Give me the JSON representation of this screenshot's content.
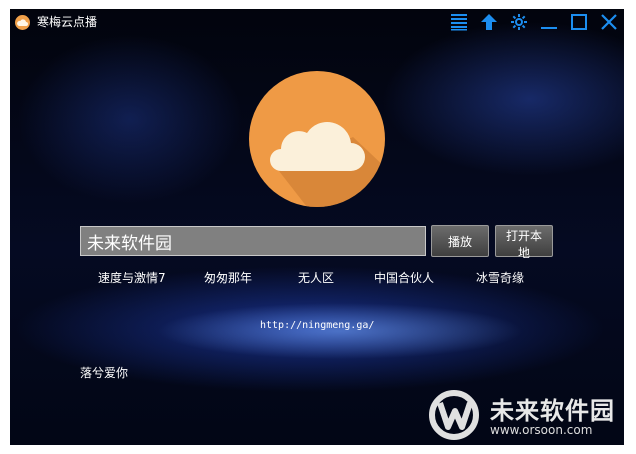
{
  "window": {
    "title": "寒梅云点播"
  },
  "titlebar": {
    "icons": [
      "list-icon",
      "upload-arrow-icon",
      "gear-icon",
      "minimize-icon",
      "maximize-icon",
      "close-icon"
    ]
  },
  "search": {
    "value": "未来软件园"
  },
  "buttons": {
    "play": "播放",
    "open_local": "打开本地"
  },
  "quick_links": [
    "速度与激情7",
    "匆匆那年",
    "无人区",
    "中国合伙人",
    "冰雪奇缘"
  ],
  "url": "http://ningmeng.ga/",
  "footer": {
    "text": "落兮爱你"
  },
  "watermark": {
    "name": "未来软件园",
    "url": "www.orsoon.com"
  },
  "colors": {
    "accent_blue": "#1c8ef0",
    "logo_orange": "#ef9a45",
    "cloud_cream": "#fbf0da"
  }
}
